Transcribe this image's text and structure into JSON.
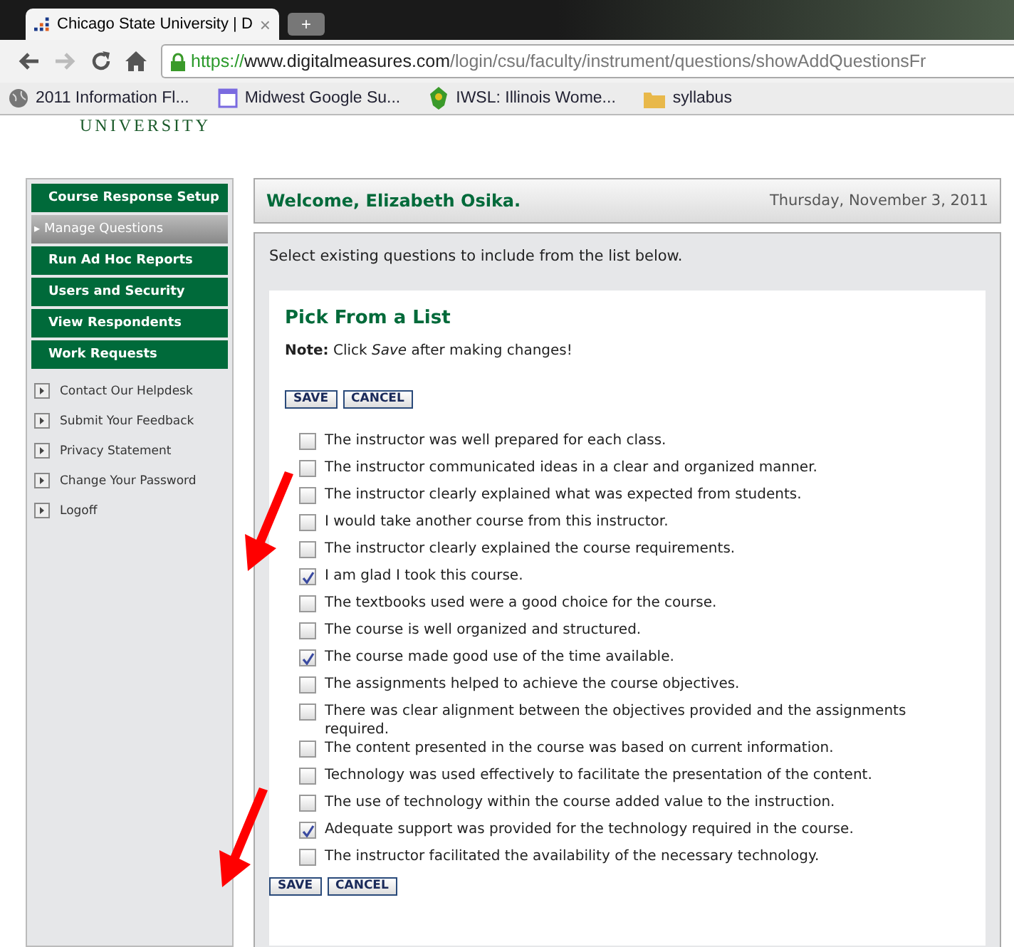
{
  "browser": {
    "tab_title": "Chicago State University | D",
    "tab_close": "×",
    "new_tab": "+",
    "url_scheme": "https://",
    "url_host": "www.digitalmeasures.com",
    "url_path": "/login/csu/faculty/instrument/questions/showAddQuestionsFr",
    "bookmarks": [
      {
        "label": "2011 Information Fl...",
        "kind": "globe"
      },
      {
        "label": "Midwest Google Su...",
        "kind": "page"
      },
      {
        "label": "IWSL: Illinois Wome...",
        "kind": "leaf"
      },
      {
        "label": "syllabus",
        "kind": "folder"
      }
    ]
  },
  "logo_text": "UNIVERSITY",
  "sidebar": {
    "menu": [
      {
        "label": "Course Response Setup",
        "selected": false
      },
      {
        "label": "Manage Questions",
        "selected": true,
        "marker": "▸"
      },
      {
        "label": "Run Ad Hoc Reports",
        "selected": false
      },
      {
        "label": "Users and Security",
        "selected": false
      },
      {
        "label": "View Respondents",
        "selected": false
      },
      {
        "label": "Work Requests",
        "selected": false
      }
    ],
    "links": [
      "Contact Our Helpdesk",
      "Submit Your Feedback",
      "Privacy Statement",
      "Change Your Password",
      "Logoff"
    ]
  },
  "welcome": "Welcome, Elizabeth Osika.",
  "date": "Thursday, November 3, 2011",
  "instructions": "Select existing questions to include from the list below.",
  "panel_title": "Pick From a List",
  "note": "**Note:** Click *Save* after making changes!",
  "buttons_top": [
    "SAVE",
    "CANCEL"
  ],
  "questions": [
    {
      "text": "The instructor was well prepared for each class.",
      "checked": false
    },
    {
      "text": "The instructor communicated ideas in a clear and organized manner.",
      "checked": false
    },
    {
      "text": "The instructor clearly explained what was expected from students.",
      "checked": false
    },
    {
      "text": "I would take another course from this instructor.",
      "checked": false
    },
    {
      "text": "The instructor clearly explained the course requirements.",
      "checked": false
    },
    {
      "text": "I am glad I took this course.",
      "checked": true
    },
    {
      "text": "The textbooks used were a good choice for the course.",
      "checked": false
    },
    {
      "text": "The course is well organized and structured.",
      "checked": false
    },
    {
      "text": "The course made good use of the time available.",
      "checked": true
    },
    {
      "text": "The assignments helped to achieve the course objectives.",
      "checked": false
    },
    {
      "text": "There was clear alignment between the objectives provided and the assignments required.",
      "checked": false
    },
    {
      "text": "The content presented in the course was based on current information.",
      "checked": false
    },
    {
      "text": "Technology was used effectively to facilitate the presentation of the content.",
      "checked": false
    },
    {
      "text": "The use of technology within the course added value to the instruction.",
      "checked": false
    },
    {
      "text": "Adequate support was provided for the technology required in the course.",
      "checked": true
    },
    {
      "text": "The instructor facilitated the availability of the necessary technology.",
      "checked": false
    }
  ],
  "buttons_bottom": [
    "SAVE",
    "CANCEL"
  ]
}
